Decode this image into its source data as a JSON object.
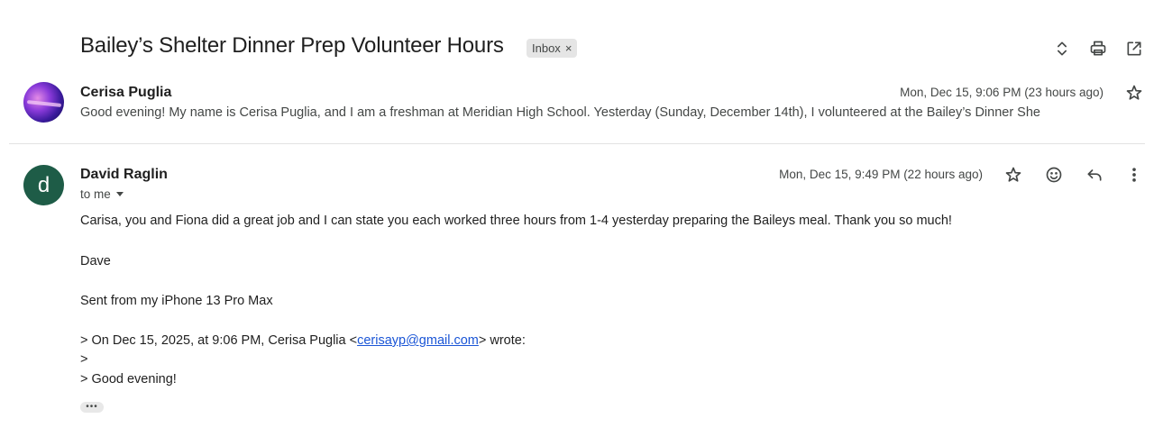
{
  "thread": {
    "subject": "Bailey’s Shelter Dinner Prep Volunteer Hours",
    "label": "Inbox",
    "label_remove": "×"
  },
  "toolbar": {
    "icons": [
      "expand-collapse-icon",
      "print-icon",
      "open-in-new-window-icon"
    ]
  },
  "messages": [
    {
      "sender": "Cerisa Puglia",
      "date": "Mon, Dec 15, 9:06 PM (23 hours ago)",
      "snippet": "Good evening! My name is Cerisa Puglia, and I am a freshman at Meridian High School. Yesterday (Sunday, December 14th), I volunteered at the Bailey’s Dinner She",
      "collapsed": true
    },
    {
      "sender": "David Raglin",
      "avatar_letter": "d",
      "avatar_color": "#1e5c47",
      "date": "Mon, Dec 15, 9:49 PM (22 hours ago)",
      "recipient": "to me",
      "body": {
        "line1": "Carisa, you and Fiona did a great job and I can state you each worked three hours from 1-4 yesterday preparing the Baileys meal. Thank you so much!",
        "signoff": "Dave",
        "sent_from": "Sent from my iPhone 13 Pro Max",
        "quote_prefix": "> On Dec 15, 2025, at 9:06 PM, Cerisa Puglia <",
        "quote_email": "cerisayp@gmail.com",
        "quote_suffix": "> wrote:",
        "quote_blank": ">",
        "quote_greeting": "> Good evening!",
        "show_trimmed": "•••"
      }
    }
  ],
  "colors": {
    "text_primary": "#1f1f1f",
    "text_secondary": "#444746",
    "link": "#1a55d6",
    "chip_bg": "#e5e5e5"
  }
}
